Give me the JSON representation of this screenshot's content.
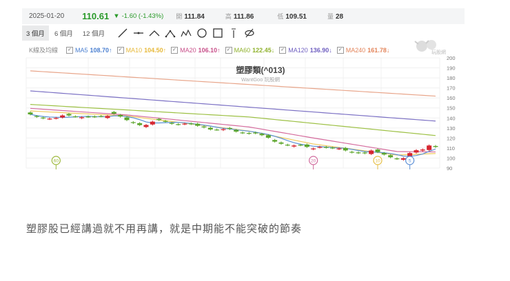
{
  "quote": {
    "date": "2025-01-20",
    "price": "110.61",
    "change": "-1.60 (-1.43%)",
    "open_label": "開",
    "open": "111.84",
    "high_label": "高",
    "high": "111.86",
    "low_label": "低",
    "low": "109.51",
    "vol_label": "量",
    "volume": "28"
  },
  "toolbar": {
    "periods": [
      "3 個月",
      "6 個月",
      "12 個月"
    ],
    "active_period": 0,
    "tools": [
      "line-tool-icon",
      "horizontal-line-icon",
      "angle-icon",
      "abc-pattern-icon",
      "abcde-pattern-icon",
      "circle-icon",
      "rectangle-icon",
      "text-marker-icon",
      "hide-drawings-icon"
    ]
  },
  "ma_row": {
    "title": "K線及均線",
    "items": [
      {
        "name": "MA5",
        "value": "108.70↑",
        "color": "#4a7fd0"
      },
      {
        "name": "MA10",
        "value": "104.50↑",
        "color": "#e7b93a"
      },
      {
        "name": "MA20",
        "value": "106.10↑",
        "color": "#c8508a"
      },
      {
        "name": "MA60",
        "value": "122.45↓",
        "color": "#8fb12c"
      },
      {
        "name": "MA120",
        "value": "136.90↓",
        "color": "#6f5fc0"
      },
      {
        "name": "MA240",
        "value": "161.78↓",
        "color": "#e3845a"
      }
    ]
  },
  "logo_text": "玩股網",
  "chart_data": {
    "type": "candlestick",
    "title": "塑膠類(^013)",
    "subtitle": "WantGoo 玩股網",
    "ylim": [
      90,
      200
    ],
    "yticks": [
      200,
      190,
      180,
      170,
      160,
      150,
      140,
      130,
      120,
      110,
      100,
      90
    ],
    "up_color": "#d6252f",
    "down_color": "#5aa52a",
    "candles": [
      [
        145.5,
        143.6
      ],
      [
        141.9,
        141.1
      ],
      [
        140.4,
        139.7
      ],
      [
        139.0,
        139.3
      ],
      [
        139.6,
        140.0
      ],
      [
        140.5,
        142.5
      ],
      [
        144.0,
        142.5
      ],
      [
        141.6,
        141.4
      ],
      [
        139.8,
        140.7
      ],
      [
        141.4,
        141.1
      ],
      [
        141.5,
        141.1
      ],
      [
        141.9,
        141.8
      ],
      [
        140.0,
        142.0
      ],
      [
        146.0,
        144.3
      ],
      [
        143.0,
        141.4
      ],
      [
        140.5,
        137.9
      ],
      [
        135.8,
        135.0
      ],
      [
        134.8,
        132.9
      ],
      [
        131.0,
        133.0
      ],
      [
        133.5,
        136.3
      ],
      [
        139.0,
        137.9
      ],
      [
        137.0,
        136.3
      ],
      [
        135.0,
        134.3
      ],
      [
        133.8,
        133.5
      ],
      [
        133.8,
        134.3
      ],
      [
        134.5,
        134.0
      ],
      [
        134.2,
        132.2
      ],
      [
        131.5,
        130.6
      ],
      [
        130.2,
        128.5
      ],
      [
        128.4,
        128.3
      ],
      [
        128.0,
        128.8
      ],
      [
        130.0,
        129.0
      ],
      [
        128.0,
        126.4
      ],
      [
        125.5,
        125.0
      ],
      [
        125.0,
        124.4
      ],
      [
        125.4,
        124.7
      ],
      [
        124.2,
        122.8
      ],
      [
        122.8,
        120.3
      ],
      [
        118.0,
        116.4
      ],
      [
        115.5,
        114.3
      ],
      [
        113.3,
        112.9
      ],
      [
        111.5,
        112.5
      ],
      [
        113.2,
        112.9
      ],
      [
        113.5,
        111.1
      ],
      [
        108.8,
        109.5
      ],
      [
        110.6,
        111.1
      ],
      [
        111.0,
        110.5
      ],
      [
        110.4,
        110.0
      ],
      [
        109.0,
        109.5
      ],
      [
        110.0,
        107.6
      ],
      [
        106.2,
        105.6
      ],
      [
        105.6,
        105.0
      ],
      [
        105.5,
        104.7
      ],
      [
        104.0,
        107.5
      ],
      [
        108.5,
        106.0
      ],
      [
        105.0,
        103.5
      ],
      [
        102.8,
        100.8
      ],
      [
        99.6,
        99.2
      ],
      [
        98.3,
        99.8
      ],
      [
        102.0,
        105.0
      ],
      [
        105.5,
        107.8
      ],
      [
        107.5,
        108.5
      ],
      [
        108.0,
        112.5
      ],
      [
        112.0,
        111.1
      ]
    ],
    "ma_lines": [
      {
        "name": "MA240",
        "color": "#e8a58a",
        "points": [
          [
            0,
            187
          ],
          [
            63,
            161.8
          ]
        ]
      },
      {
        "name": "MA120",
        "color": "#7b70c4",
        "points": [
          [
            0,
            167
          ],
          [
            63,
            136.9
          ]
        ]
      },
      {
        "name": "MA60",
        "color": "#9cc043",
        "points": [
          [
            0,
            153.5
          ],
          [
            34,
            141
          ],
          [
            63,
            122.45
          ]
        ]
      },
      {
        "name": "MA20",
        "color": "#d46a9c",
        "points": [
          [
            0,
            149.6
          ],
          [
            15,
            143
          ],
          [
            34,
            131
          ],
          [
            44,
            120
          ],
          [
            57,
            106.5
          ],
          [
            63,
            106.1
          ]
        ]
      },
      {
        "name": "MA10",
        "color": "#efc85a",
        "points": [
          [
            0,
            147
          ],
          [
            15,
            142
          ],
          [
            34,
            127
          ],
          [
            44,
            114
          ],
          [
            57,
            103
          ],
          [
            63,
            104.5
          ]
        ]
      }
    ],
    "ma5_color": "#5a92d6",
    "markers": [
      {
        "label": "60",
        "index": 4,
        "color": "#9cb83a"
      },
      {
        "label": "20",
        "index": 44,
        "color": "#d06a9c"
      },
      {
        "label": "10",
        "index": 54,
        "color": "#e6bf45"
      },
      {
        "label": "5",
        "index": 59,
        "color": "#5b8fd6"
      }
    ]
  },
  "caption": "塑膠股已經講過就不用再講，就是中期能不能突破的節奏"
}
